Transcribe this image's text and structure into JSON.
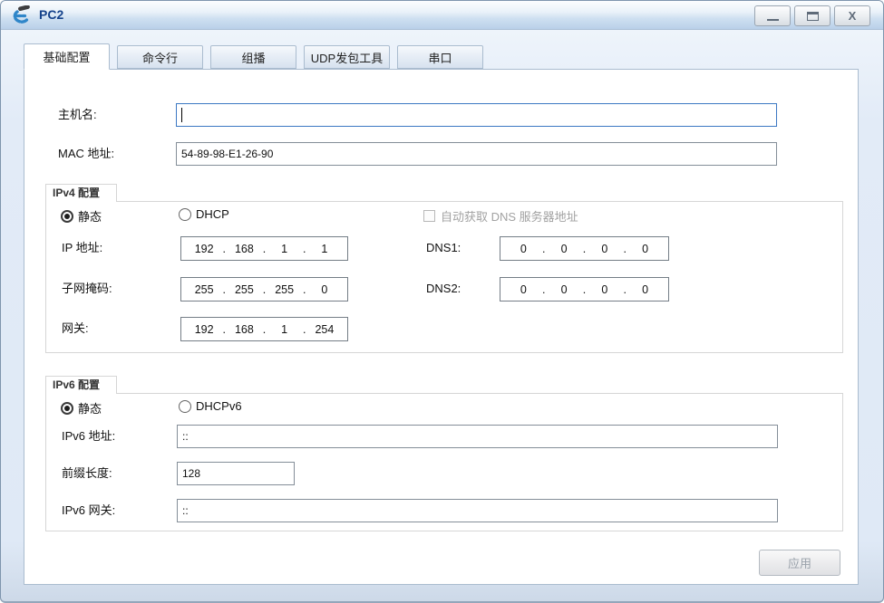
{
  "sep": ".",
  "window": {
    "title": "PC2",
    "close_glyph": "X"
  },
  "tabs": [
    {
      "label": "基础配置"
    },
    {
      "label": "命令行"
    },
    {
      "label": "组播"
    },
    {
      "label": "UDP发包工具"
    },
    {
      "label": "串口"
    }
  ],
  "form": {
    "hostname_label": "主机名:",
    "hostname_value": "",
    "mac_label": "MAC 地址:",
    "mac_value": "54-89-98-E1-26-90",
    "apply_label": "应用",
    "ipv4": {
      "group_label": "IPv4 配置",
      "static_label": "静态",
      "dhcp_label": "DHCP",
      "auto_dns_label": "自动获取 DNS 服务器地址",
      "ip_label": "IP 地址:",
      "ip": [
        "192",
        "168",
        "1",
        "1"
      ],
      "mask_label": "子网掩码:",
      "mask": [
        "255",
        "255",
        "255",
        "0"
      ],
      "gateway_label": "网关:",
      "gateway": [
        "192",
        "168",
        "1",
        "254"
      ],
      "dns1_label": "DNS1:",
      "dns1": [
        "0",
        "0",
        "0",
        "0"
      ],
      "dns2_label": "DNS2:",
      "dns2": [
        "0",
        "0",
        "0",
        "0"
      ]
    },
    "ipv6": {
      "group_label": "IPv6 配置",
      "static_label": "静态",
      "dhcpv6_label": "DHCPv6",
      "address_label": "IPv6 地址:",
      "address_value": "::",
      "prefix_label": "前缀长度:",
      "prefix_value": "128",
      "gateway_label": "IPv6 网关:",
      "gateway_value": "::"
    }
  },
  "colors": {
    "titlebar_text": "#15428b",
    "focus_border": "#3c78c3",
    "disabled_text": "#a2a2a2",
    "frame": "#dfe9f6"
  }
}
